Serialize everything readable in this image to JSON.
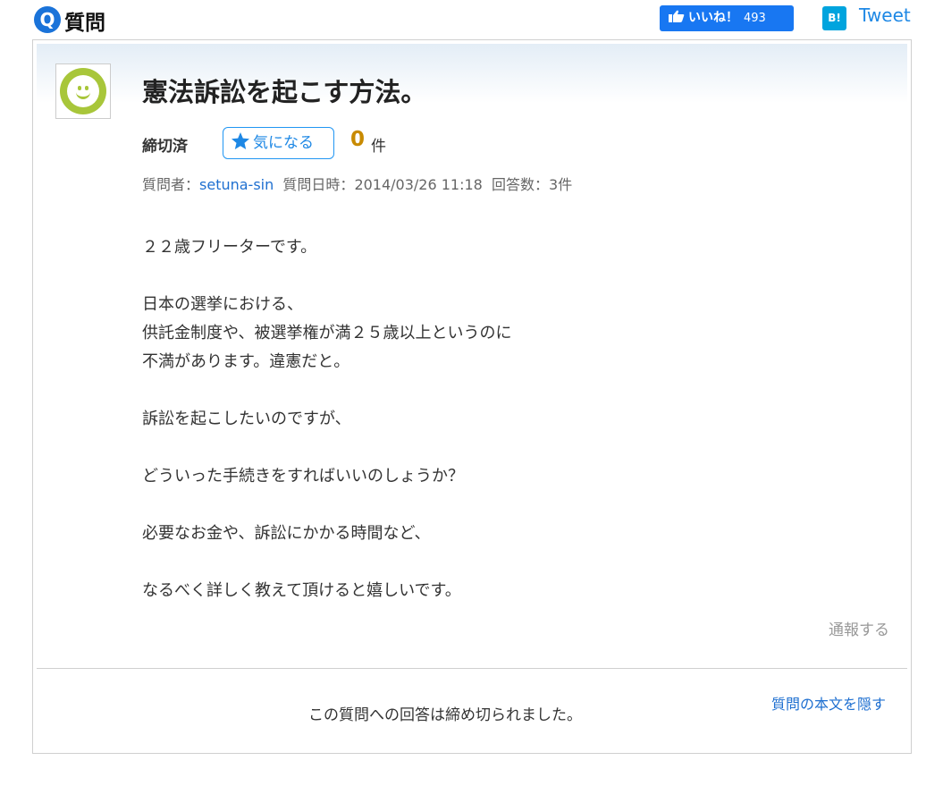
{
  "header": {
    "q_badge": "Q",
    "section_title": "質問",
    "like_label": "いいね！",
    "like_count": "493",
    "hatena_label": "B!",
    "tweet_label": "Tweet"
  },
  "question": {
    "title": "憲法訴訟を起こす方法。",
    "status": "締切済",
    "watch_label": "気になる",
    "watch_count": "0",
    "watch_unit": "件",
    "meta": {
      "asker_label": "質問者：",
      "asker": "setuna-sin",
      "date_label": "質問日時：",
      "date": "2014/03/26 11:18",
      "answers_label": "回答数：",
      "answers": "3件"
    },
    "paragraphs": [
      [
        "２２歳フリーターです。"
      ],
      [
        "日本の選挙における、",
        "供託金制度や、被選挙権が満２５歳以上というのに",
        "不満があります。違憲だと。"
      ],
      [
        "訴訟を起こしたいのですが、"
      ],
      [
        "どういった手続きをすればいいのしょうか？"
      ],
      [
        "必要なお金や、訴訟にかかる時間など、"
      ],
      [
        "なるべく詳しく教えて頂けると嬉しいです。"
      ]
    ],
    "report_label": "通報する",
    "closed_message": "この質問への回答は締め切られました。",
    "hide_body_label": "質問の本文を隠す"
  },
  "colors": {
    "accent_blue": "#1a73d9",
    "facebook_blue": "#1877f2",
    "hatena_blue": "#00a4de",
    "count_orange": "#c88a00",
    "avatar_green": "#a8c63a"
  }
}
